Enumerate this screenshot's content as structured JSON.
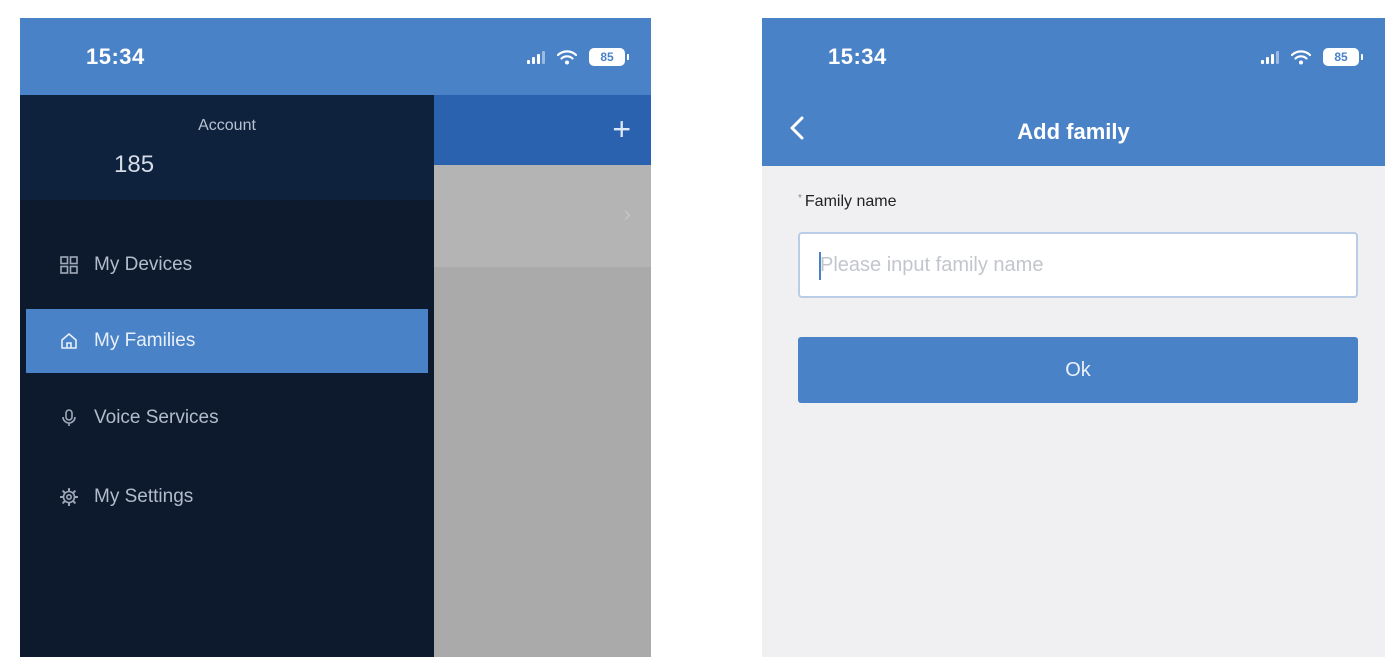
{
  "left_screen": {
    "status_bar": {
      "time": "15:34",
      "battery": "85"
    },
    "add_icon": "plus-icon",
    "drawer": {
      "account_title": "Account",
      "account_value": "185",
      "items": [
        {
          "label": "My Devices",
          "icon": "devices-grid-icon",
          "active": false
        },
        {
          "label": "My Families",
          "icon": "home-icon",
          "active": true
        },
        {
          "label": "Voice Services",
          "icon": "microphone-icon",
          "active": false
        },
        {
          "label": "My Settings",
          "icon": "settings-gear-icon",
          "active": false
        }
      ]
    }
  },
  "right_screen": {
    "status_bar": {
      "time": "15:34",
      "battery": "85"
    },
    "nav": {
      "title": "Add family",
      "back_icon": "back-chevron-icon"
    },
    "form": {
      "required_mark": "*",
      "label": "Family name",
      "placeholder": "Please input family name",
      "value": "",
      "ok_label": "Ok"
    }
  },
  "colors": {
    "accent": "#4a82c8",
    "drawer_bg": "#0d1a2e",
    "overlay_bg": "#aaaaab",
    "form_bg": "#f0f0f2"
  }
}
